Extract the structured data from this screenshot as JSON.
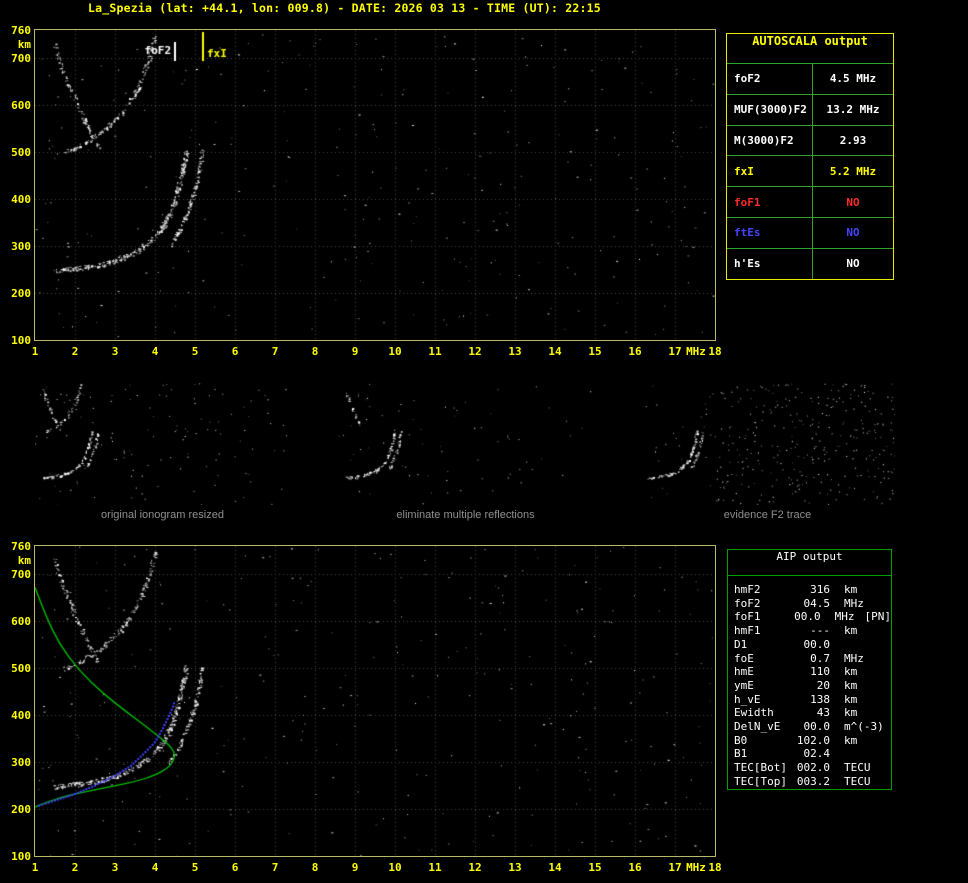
{
  "title_bar": {
    "text": "La_Spezia (lat: +44.1, lon: 009.8) - DATE: 2026 03 13 - TIME (UT): 22:15"
  },
  "autoscala": {
    "title": "AUTOSCALA output",
    "rows": [
      {
        "label": "foF2",
        "value": "4.5 MHz",
        "color": "#ffffff"
      },
      {
        "label": "MUF(3000)F2",
        "value": "13.2 MHz",
        "color": "#ffffff"
      },
      {
        "label": "M(3000)F2",
        "value": "2.93",
        "color": "#ffffff"
      },
      {
        "label": "fxI",
        "value": "5.2 MHz",
        "color": "#ffff00"
      },
      {
        "label": "foF1",
        "value": "NO",
        "color": "#ff2a2a"
      },
      {
        "label": "ftEs",
        "value": "NO",
        "color": "#4545ff"
      },
      {
        "label": "h'Es",
        "value": "NO",
        "color": "#ffffff"
      }
    ]
  },
  "thumbnails": [
    {
      "caption": "original ionogram resized"
    },
    {
      "caption": "eliminate multiple reflections"
    },
    {
      "caption": "evidence F2 trace"
    }
  ],
  "aip": {
    "title": "AIP output",
    "rows": [
      {
        "name": "hmF2",
        "value": "316",
        "unit": "km",
        "extra": ""
      },
      {
        "name": "foF2",
        "value": "04.5",
        "unit": "MHz",
        "extra": ""
      },
      {
        "name": "foF1",
        "value": "00.0",
        "unit": "MHz",
        "extra": "[PN]"
      },
      {
        "name": "hmF1",
        "value": "---",
        "unit": "km",
        "extra": ""
      },
      {
        "name": "D1",
        "value": "00.0",
        "unit": "",
        "extra": ""
      },
      {
        "name": "foE",
        "value": "0.7",
        "unit": "MHz",
        "extra": ""
      },
      {
        "name": "hmE",
        "value": "110",
        "unit": "km",
        "extra": ""
      },
      {
        "name": "ymE",
        "value": "20",
        "unit": "km",
        "extra": ""
      },
      {
        "name": "h_vE",
        "value": "138",
        "unit": "km",
        "extra": ""
      },
      {
        "name": "Ewidth",
        "value": "43",
        "unit": "km",
        "extra": ""
      },
      {
        "name": "DelN_vE",
        "value": "00.0",
        "unit": "m^(-3)",
        "extra": ""
      },
      {
        "name": "B0",
        "value": "102.0",
        "unit": "km",
        "extra": ""
      },
      {
        "name": "B1",
        "value": "02.4",
        "unit": "",
        "extra": ""
      },
      {
        "name": "TEC[Bot]",
        "value": "002.0",
        "unit": "TECU",
        "extra": ""
      },
      {
        "name": "TEC[Top]",
        "value": "003.2",
        "unit": "TECU",
        "extra": ""
      }
    ]
  },
  "chart_data": [
    {
      "id": "ionogram-top",
      "type": "scatter",
      "xlabel": "MHz",
      "ylabel": "km",
      "xlim": [
        1,
        18
      ],
      "ylim": [
        100,
        760
      ],
      "xticks": [
        1,
        2,
        3,
        4,
        5,
        6,
        7,
        8,
        9,
        10,
        11,
        12,
        13,
        14,
        15,
        16,
        17,
        18
      ],
      "yticks": [
        760,
        700,
        600,
        500,
        400,
        300,
        200,
        100
      ],
      "grid": true,
      "noise_points": 300,
      "markers": [
        {
          "label": "foF2",
          "x": 4.5,
          "value_mhz": 4.5,
          "color": "#ffffff"
        },
        {
          "label": "fxI",
          "x": 5.2,
          "value_mhz": 5.2,
          "color": "#ffff00"
        }
      ],
      "traces": [
        {
          "name": "F2 ordinary trace",
          "color": "#ffffff",
          "density": 1.6,
          "spread": 2.2,
          "points": [
            [
              1.5,
              248
            ],
            [
              2.0,
              253
            ],
            [
              2.5,
              259
            ],
            [
              3.0,
              269
            ],
            [
              3.5,
              287
            ],
            [
              3.9,
              313
            ],
            [
              4.2,
              343
            ],
            [
              4.45,
              388
            ],
            [
              4.6,
              432
            ],
            [
              4.7,
              472
            ],
            [
              4.78,
              505
            ]
          ]
        },
        {
          "name": "F2 extraordinary trace",
          "color": "#ffffff",
          "density": 1.1,
          "spread": 1.8,
          "points": [
            [
              4.35,
              298
            ],
            [
              4.6,
              333
            ],
            [
              4.8,
              373
            ],
            [
              5.0,
              423
            ],
            [
              5.1,
              463
            ],
            [
              5.18,
              505
            ]
          ]
        },
        {
          "name": "F2 second hop",
          "color": "#e8e8e8",
          "density": 0.9,
          "spread": 2.0,
          "points": [
            [
              1.7,
              498
            ],
            [
              2.2,
              517
            ],
            [
              2.7,
              547
            ],
            [
              3.2,
              588
            ],
            [
              3.6,
              643
            ],
            [
              3.85,
              700
            ],
            [
              4.0,
              752
            ]
          ]
        },
        {
          "name": "oblique spread echo",
          "color": "#dddddd",
          "density": 0.8,
          "spread": 2.0,
          "points": [
            [
              1.45,
              735
            ],
            [
              1.7,
              672
            ],
            [
              2.0,
              612
            ],
            [
              2.3,
              556
            ],
            [
              2.6,
              512
            ]
          ]
        }
      ]
    },
    {
      "id": "ionogram-bottom",
      "type": "scatter",
      "xlabel": "MHz",
      "ylabel": "km",
      "xlim": [
        1,
        18
      ],
      "ylim": [
        100,
        760
      ],
      "xticks": [
        1,
        2,
        3,
        4,
        5,
        6,
        7,
        8,
        9,
        10,
        11,
        12,
        13,
        14,
        15,
        16,
        17,
        18
      ],
      "yticks": [
        760,
        700,
        600,
        500,
        400,
        300,
        200,
        100
      ],
      "grid": true,
      "noise_points": 300,
      "traces": [
        {
          "name": "F2 ordinary trace",
          "color": "#ffffff",
          "density": 1.6,
          "spread": 2.2,
          "points": [
            [
              1.5,
              248
            ],
            [
              2.0,
              253
            ],
            [
              2.5,
              259
            ],
            [
              3.0,
              269
            ],
            [
              3.5,
              287
            ],
            [
              3.9,
              313
            ],
            [
              4.2,
              343
            ],
            [
              4.45,
              388
            ],
            [
              4.6,
              432
            ],
            [
              4.7,
              472
            ],
            [
              4.78,
              505
            ]
          ]
        },
        {
          "name": "F2 extraordinary trace",
          "color": "#ffffff",
          "density": 1.1,
          "spread": 1.8,
          "points": [
            [
              4.35,
              298
            ],
            [
              4.6,
              333
            ],
            [
              4.8,
              373
            ],
            [
              5.0,
              423
            ],
            [
              5.1,
              463
            ],
            [
              5.18,
              505
            ]
          ]
        },
        {
          "name": "F2 second hop",
          "color": "#e8e8e8",
          "density": 0.9,
          "spread": 2.0,
          "points": [
            [
              1.7,
              498
            ],
            [
              2.2,
              517
            ],
            [
              2.7,
              547
            ],
            [
              3.2,
              588
            ],
            [
              3.6,
              643
            ],
            [
              3.85,
              700
            ],
            [
              4.0,
              752
            ]
          ]
        },
        {
          "name": "oblique spread echo",
          "color": "#dddddd",
          "density": 0.8,
          "spread": 2.0,
          "points": [
            [
              1.45,
              735
            ],
            [
              1.7,
              672
            ],
            [
              2.0,
              612
            ],
            [
              2.3,
              556
            ],
            [
              2.6,
              512
            ]
          ]
        }
      ],
      "profile": {
        "name": "electron density profile",
        "color": "#00c000",
        "points": [
          [
            1.0,
            672
          ],
          [
            1.25,
            615
          ],
          [
            1.6,
            552
          ],
          [
            2.1,
            495
          ],
          [
            2.7,
            446
          ],
          [
            3.3,
            406
          ],
          [
            3.8,
            374
          ],
          [
            4.2,
            348
          ],
          [
            4.42,
            330
          ],
          [
            4.5,
            316
          ],
          [
            4.45,
            300
          ],
          [
            4.3,
            286
          ],
          [
            4.0,
            272
          ],
          [
            3.5,
            258
          ],
          [
            2.9,
            248
          ],
          [
            2.2,
            236
          ],
          [
            1.6,
            224
          ],
          [
            1.1,
            208
          ],
          [
            1.0,
            204
          ]
        ]
      },
      "scaled_trace": {
        "name": "autoscala restored trace",
        "color": "#4040ff",
        "points": [
          [
            1.1,
            207
          ],
          [
            1.5,
            218
          ],
          [
            2.0,
            232
          ],
          [
            2.5,
            250
          ],
          [
            3.0,
            271
          ],
          [
            3.4,
            292
          ],
          [
            3.7,
            316
          ],
          [
            4.0,
            342
          ],
          [
            4.2,
            372
          ],
          [
            4.35,
            398
          ],
          [
            4.45,
            418
          ],
          [
            4.5,
            432
          ]
        ]
      }
    },
    {
      "id": "thumb-original",
      "type": "scatter",
      "noise_points": 130,
      "extra_right_noise": 0,
      "use_traces": [
        0,
        1,
        2,
        3
      ]
    },
    {
      "id": "thumb-eliminate",
      "type": "scatter",
      "noise_points": 70,
      "extra_right_noise": 0,
      "use_traces": [
        0,
        1,
        3
      ]
    },
    {
      "id": "thumb-evidence",
      "type": "scatter",
      "noise_points": 110,
      "extra_right_noise": 240,
      "use_traces": [
        0,
        1
      ]
    }
  ]
}
